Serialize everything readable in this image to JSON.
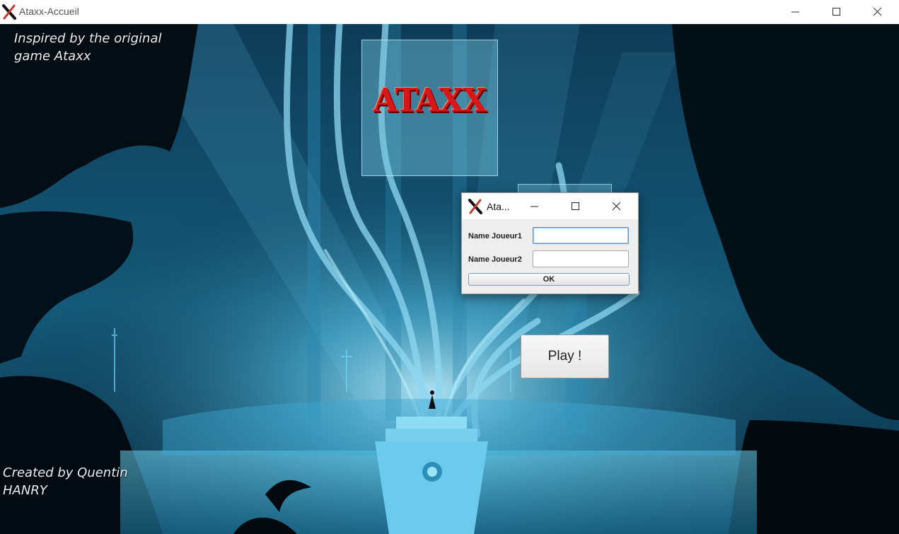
{
  "window": {
    "title": "Ataxx-Accueil",
    "icon": "ataxx-x-icon"
  },
  "scene": {
    "credit_top": [
      "Inspired by the original",
      "game Ataxx"
    ],
    "credit_bottom": [
      "Created by Quentin",
      "HANRY"
    ],
    "logo_text": "ATAXX",
    "play_label": "Play !"
  },
  "dialog": {
    "title": "Ata...",
    "fields": [
      {
        "label": "Name Joueur1",
        "value": "",
        "focused": true
      },
      {
        "label": "Name Joueur2",
        "value": ""
      }
    ],
    "ok_label": "OK"
  },
  "colors": {
    "logo_red": "#d81818",
    "scene_dark": "#0b2f45",
    "focus_blue": "#5b8fc8"
  }
}
